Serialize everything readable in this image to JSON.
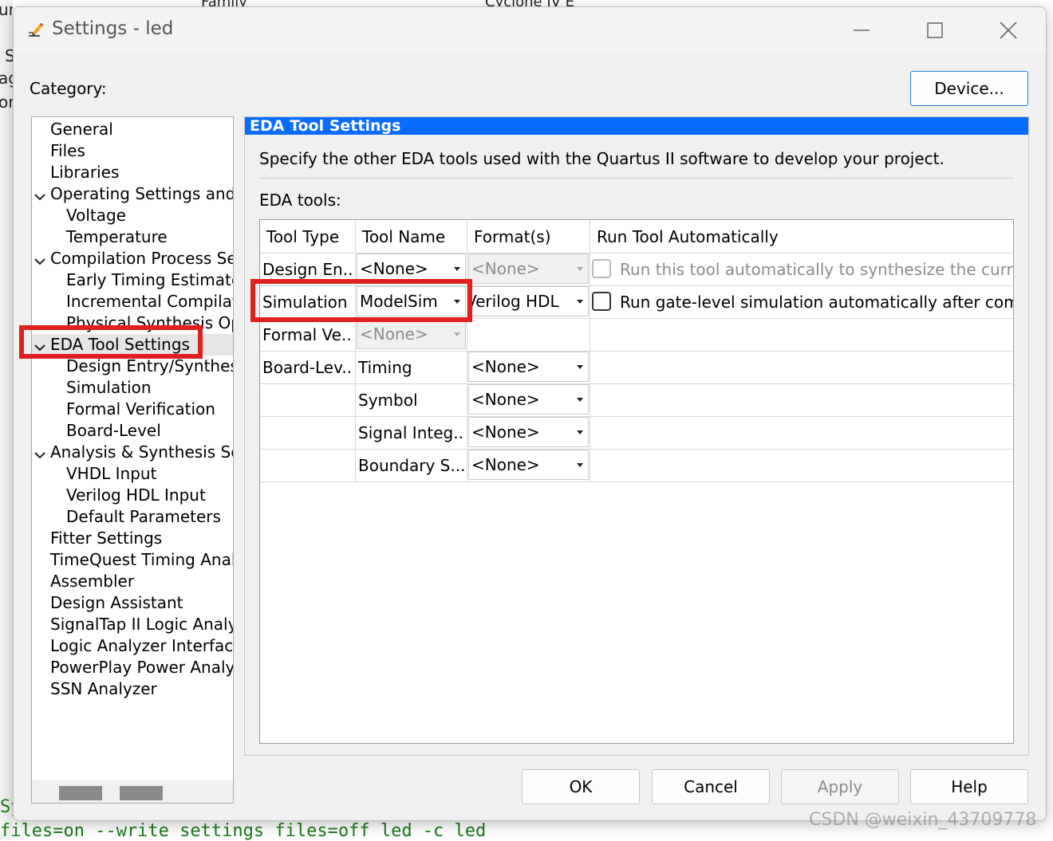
{
  "background": {
    "top_left_text": "Family",
    "top_right_text": "Cyclone IV E",
    "left_fragments": [
      "ur",
      "S",
      "ag",
      "ore"
    ],
    "sy_text": "Sy",
    "command_text": "files=on --write settings files=off led -c led"
  },
  "dialog": {
    "title": "Settings - led",
    "category_label": "Category:",
    "device_button": "Device..."
  },
  "tree": [
    {
      "label": "General"
    },
    {
      "label": "Files"
    },
    {
      "label": "Libraries"
    },
    {
      "label": "Operating Settings and C"
    },
    {
      "label": "Voltage"
    },
    {
      "label": "Temperature"
    },
    {
      "label": "Compilation Process Setti"
    },
    {
      "label": "Early Timing Estimate"
    },
    {
      "label": "Incremental Compilatio"
    },
    {
      "label": "Physical Synthesis Opt"
    },
    {
      "label": "EDA Tool Settings"
    },
    {
      "label": "Design Entry/Synthesis"
    },
    {
      "label": "Simulation"
    },
    {
      "label": "Formal Verification"
    },
    {
      "label": "Board-Level"
    },
    {
      "label": "Analysis & Synthesis Setti"
    },
    {
      "label": "VHDL Input"
    },
    {
      "label": "Verilog HDL Input"
    },
    {
      "label": "Default Parameters"
    },
    {
      "label": "Fitter Settings"
    },
    {
      "label": "TimeQuest Timing Analy"
    },
    {
      "label": "Assembler"
    },
    {
      "label": "Design Assistant"
    },
    {
      "label": "SignalTap II Logic Analy"
    },
    {
      "label": "Logic Analyzer Interface"
    },
    {
      "label": "PowerPlay Power Analyz"
    },
    {
      "label": "SSN Analyzer"
    }
  ],
  "panel": {
    "header": "EDA Tool Settings",
    "description": "Specify the other EDA tools used with the Quartus II software to develop your project.",
    "eda_tools_label": "EDA tools:",
    "columns": [
      "Tool Type",
      "Tool Name",
      "Format(s)",
      "Run Tool Automatically"
    ],
    "rows": [
      {
        "tool_type": "Design En...",
        "tool_name": "<None>",
        "format": "<None>",
        "run_text": "Run this tool automatically to synthesize the current"
      },
      {
        "tool_type": "Simulation",
        "tool_name": "ModelSim",
        "format": "Verilog HDL",
        "run_text": "Run gate-level simulation automatically after compila"
      },
      {
        "tool_type": "Formal Ve...",
        "tool_name": "<None>"
      },
      {
        "tool_type": "Board-Lev...",
        "tool_name": "Timing",
        "format": "<None>"
      },
      {
        "tool_name": "Symbol",
        "format": "<None>"
      },
      {
        "tool_name": "Signal Integ...",
        "format": "<None>"
      },
      {
        "tool_name": "Boundary S...",
        "format": "<None>"
      }
    ]
  },
  "buttons": {
    "ok": "OK",
    "cancel": "Cancel",
    "apply": "Apply",
    "help": "Help"
  },
  "watermark": "CSDN @weixin_43709778",
  "colors": {
    "header_blue": "#0a6cff",
    "highlight_red": "#e0201f"
  }
}
